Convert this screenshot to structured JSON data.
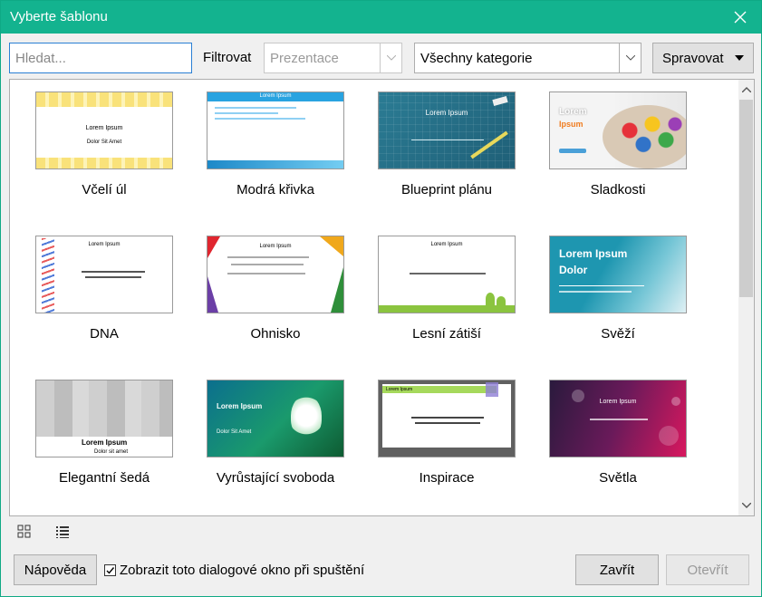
{
  "window": {
    "title": "Vyberte šablonu"
  },
  "toolbar": {
    "search_placeholder": "Hledat...",
    "filter_label": "Filtrovat",
    "filter_value": "Prezentace",
    "category_value": "Všechny kategorie",
    "manage_label": "Spravovat"
  },
  "templates": [
    {
      "name": "Včelí úl",
      "title": "Lorem Ipsum",
      "sub": "Dolor Sit Amet"
    },
    {
      "name": "Modrá křivka",
      "title": "Lorem Ipsum"
    },
    {
      "name": "Blueprint plánu",
      "title": "Lorem Ipsum"
    },
    {
      "name": "Sladkosti",
      "title": "Lorem",
      "sub": "Ipsum"
    },
    {
      "name": "DNA",
      "title": "Lorem Ipsum"
    },
    {
      "name": "Ohnisko",
      "title": "Lorem Ipsum"
    },
    {
      "name": "Lesní zátiší",
      "title": "Lorem Ipsum"
    },
    {
      "name": "Svěží",
      "title": "Lorem Ipsum Dolor"
    },
    {
      "name": "Elegantní šedá",
      "title": "Lorem Ipsum",
      "sub": "Dolor sit amet"
    },
    {
      "name": "Vyrůstající svoboda",
      "title": "Lorem Ipsum",
      "sub": "Dolor Sit Amet"
    },
    {
      "name": "Inspirace",
      "title": "Lorem Ipsum"
    },
    {
      "name": "Světla",
      "title": "Lorem Ipsum"
    }
  ],
  "footer": {
    "help_label": "Nápověda",
    "show_on_startup_label": "Zobrazit toto dialogové okno při spuštění",
    "show_on_startup_checked": true,
    "close_label": "Zavřít",
    "open_label": "Otevřít"
  },
  "colors": {
    "titlebar": "#13b38f",
    "focus": "#2a7fd4"
  }
}
